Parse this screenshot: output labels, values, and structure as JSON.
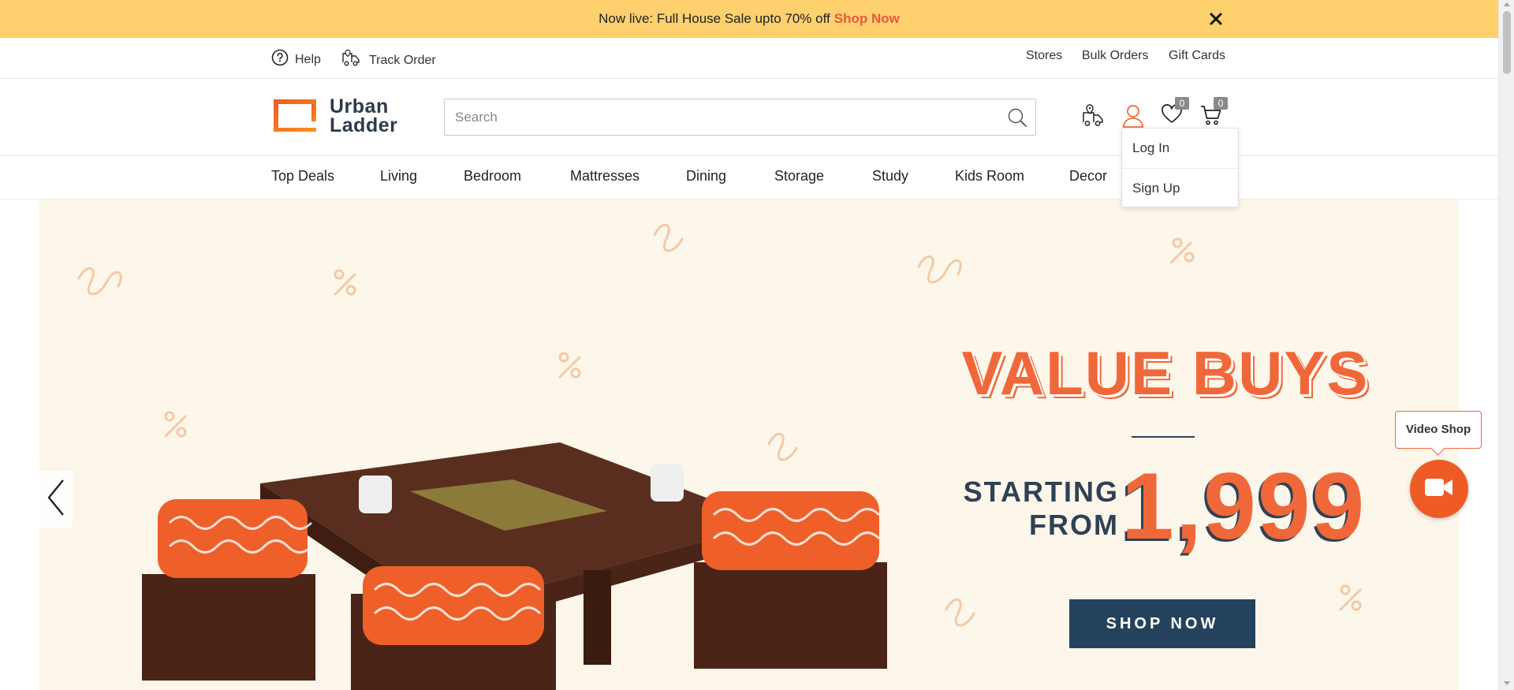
{
  "promo": {
    "text": "Now live: Full House Sale upto 70% off",
    "link_label": "Shop Now"
  },
  "utility": {
    "help_label": "Help",
    "track_order_label": "Track Order",
    "stores_label": "Stores",
    "bulk_orders_label": "Bulk Orders",
    "gift_cards_label": "Gift Cards"
  },
  "header": {
    "logo_line1": "Urban",
    "logo_line2": "Ladder",
    "search_placeholder": "Search",
    "wishlist_count": "0",
    "cart_count": "0"
  },
  "account_menu": {
    "login_label": "Log In",
    "signup_label": "Sign Up"
  },
  "nav": {
    "items": [
      "Top Deals",
      "Living",
      "Bedroom",
      "Mattresses",
      "Dining",
      "Storage",
      "Study",
      "Kids Room",
      "Decor"
    ]
  },
  "hero": {
    "headline": "VALUE BUYS",
    "starting_line1": "STARTING",
    "starting_line2": "FROM",
    "price": "1,999",
    "button_label": "SHOP NOW"
  },
  "video_shop": {
    "label": "Video Shop"
  },
  "colors": {
    "promo_bg": "#fed06e",
    "accent": "#f0683a",
    "navy": "#25425c",
    "hero_bg": "#fdf6ea"
  },
  "icons": [
    "close-icon",
    "help-icon",
    "truck-icon",
    "search-icon",
    "location-truck-icon",
    "user-icon",
    "heart-icon",
    "cart-icon",
    "chevron-left-icon",
    "video-camera-icon"
  ]
}
